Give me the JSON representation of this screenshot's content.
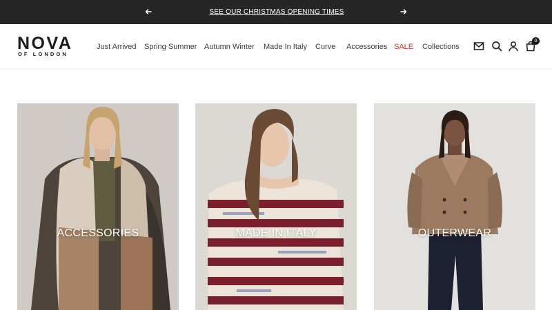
{
  "announcement": {
    "message": "SEE OUR CHRISTMAS OPENING TIMES",
    "prev_icon": "arrow-left-icon",
    "next_icon": "arrow-right-icon"
  },
  "brand": {
    "name": "NOVA",
    "tagline": "OF LONDON"
  },
  "nav": {
    "items": [
      {
        "label": "Just Arrived"
      },
      {
        "label": "Spring Summer"
      },
      {
        "label": "Autumn Winter"
      },
      {
        "label": "Made In Italy"
      },
      {
        "label": "Curve"
      },
      {
        "label": "Accessories"
      },
      {
        "label": "SALE"
      },
      {
        "label": "Collections"
      }
    ],
    "sale_color": "#d8302f"
  },
  "header_icons": {
    "mail": "mail-icon",
    "search": "search-icon",
    "account": "account-icon",
    "cart": "cart-icon",
    "cart_count": "0"
  },
  "categories": [
    {
      "label": "ACCESSORIES"
    },
    {
      "label": "MADE IN ITALY"
    },
    {
      "label": "OUTERWEAR"
    }
  ],
  "colors": {
    "announcement_bg": "#262626",
    "text": "#3a3a3a",
    "accent_sale": "#d8302f"
  }
}
